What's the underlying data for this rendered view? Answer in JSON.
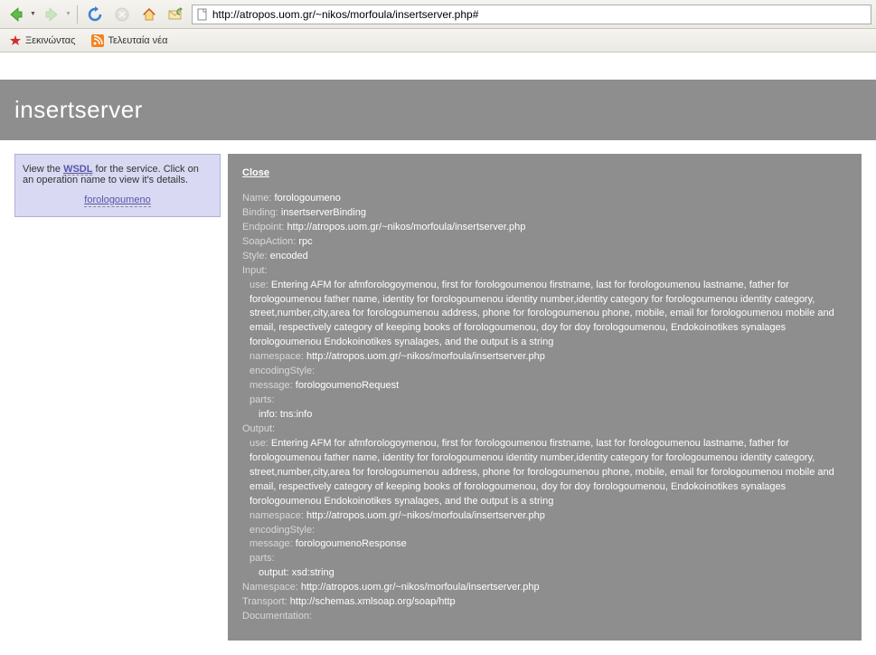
{
  "browser": {
    "url": "http://atropos.uom.gr/~nikos/morfoula/insertserver.php#",
    "bookmarks": [
      {
        "icon": "red-star",
        "label": "Ξεκινώντας"
      },
      {
        "icon": "rss",
        "label": "Τελευταία νέα"
      }
    ]
  },
  "page": {
    "title": "insertserver",
    "side": {
      "pre": "View the ",
      "wsdl": "WSDL",
      "post": " for the service. Click on an operation name to view it's details.",
      "op_link": "forologoumeno"
    },
    "details": {
      "close": "Close",
      "name_l": "Name:",
      "name_v": "forologoumeno",
      "binding_l": "Binding:",
      "binding_v": "insertserverBinding",
      "endpoint_l": "Endpoint:",
      "endpoint_v": "http://atropos.uom.gr/~nikos/morfoula/insertserver.php",
      "soapaction_l": "SoapAction:",
      "soapaction_v": "rpc",
      "style_l": "Style:",
      "style_v": "encoded",
      "input_l": "Input:",
      "input_use_l": "use:",
      "input_use_v": "Entering AFM for afmforologoymenou, first for forologoumenou firstname, last for forologoumenou lastname, father for forologoumenou father name, identity for forologoumenou identity number,identity category for forologoumenou identity category, street,number,city,area for forologoumenou address, phone for forologoumenou phone, mobile, email for forologoumenou mobile and email, respectively category of keeping books of forologoumenou, doy for doy forologoumenou, Endokoinotikes synalages forologoumenou Endokoinotikes synalages, and the output is a string",
      "input_ns_l": "namespace:",
      "input_ns_v": "http://atropos.uom.gr/~nikos/morfoula/insertserver.php",
      "input_enc_l": "encodingStyle:",
      "input_msg_l": "message:",
      "input_msg_v": "forologoumenoRequest",
      "input_parts_l": "parts:",
      "input_part1": "info: tns:info",
      "output_l": "Output:",
      "output_use_l": "use:",
      "output_use_v": "Entering AFM for afmforologoymenou, first for forologoumenou firstname, last for forologoumenou lastname, father for forologoumenou father name, identity for forologoumenou identity number,identity category for forologoumenou identity category, street,number,city,area for forologoumenou address, phone for forologoumenou phone, mobile, email for forologoumenou mobile and email, respectively category of keeping books of forologoumenou, doy for doy forologoumenou, Endokoinotikes synalages forologoumenou Endokoinotikes synalages, and the output is a string",
      "output_ns_l": "namespace:",
      "output_ns_v": "http://atropos.uom.gr/~nikos/morfoula/insertserver.php",
      "output_enc_l": "encodingStyle:",
      "output_msg_l": "message:",
      "output_msg_v": "forologoumenoResponse",
      "output_parts_l": "parts:",
      "output_part1": "output: xsd:string",
      "namespace_l": "Namespace:",
      "namespace_v": "http://atropos.uom.gr/~nikos/morfoula/insertserver.php",
      "transport_l": "Transport:",
      "transport_v": "http://schemas.xmlsoap.org/soap/http",
      "doc_l": "Documentation:"
    }
  }
}
